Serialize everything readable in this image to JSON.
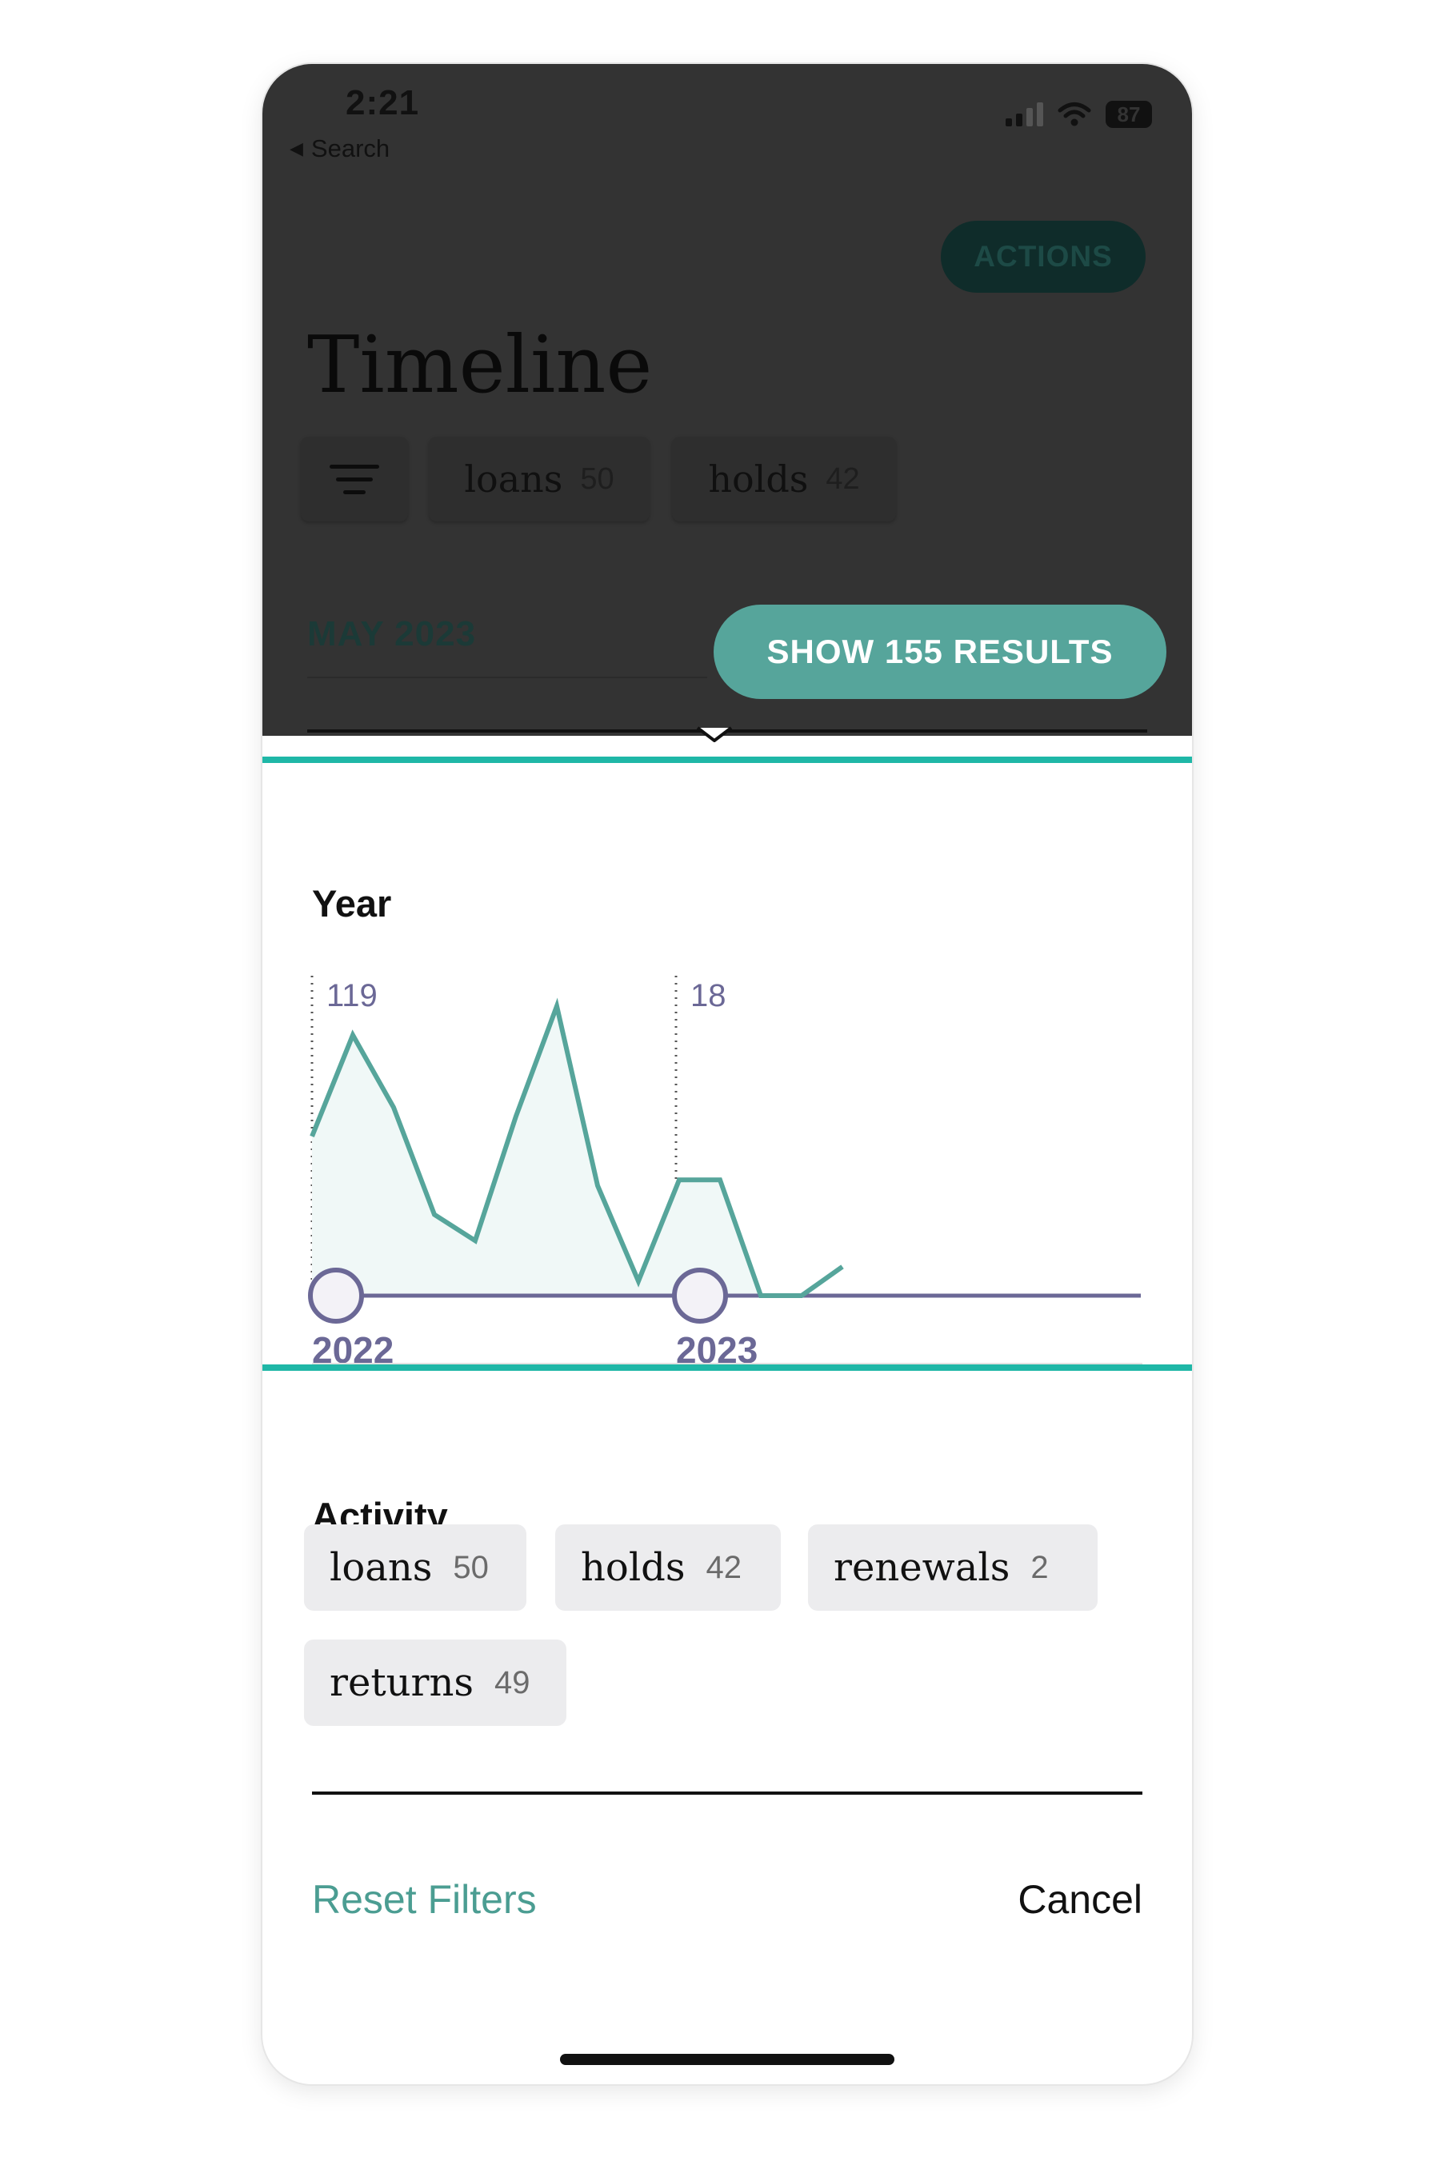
{
  "status_bar": {
    "time": "2:21",
    "back_label": "Search",
    "battery": "87"
  },
  "header": {
    "actions_label": "ACTIONS",
    "title": "Timeline",
    "chips": [
      {
        "label": "loans",
        "count": "50"
      },
      {
        "label": "holds",
        "count": "42"
      }
    ]
  },
  "list": {
    "month_label": "MAY 2023"
  },
  "show_results_label": "SHOW 155 RESULTS",
  "year_section": {
    "title": "Year",
    "markers": [
      {
        "year": "2022",
        "count": "119"
      },
      {
        "year": "2023",
        "count": "18"
      }
    ]
  },
  "chart_data": {
    "type": "area",
    "title": "Year",
    "x_labels": [
      "2022",
      "2023"
    ],
    "peak_labels": [
      "119",
      "18"
    ],
    "values": [
      0.55,
      0.9,
      0.65,
      0.28,
      0.19,
      0.62,
      1.0,
      0.38,
      0.05,
      0.4,
      0.4,
      0.0,
      0.0,
      0.1
    ],
    "ylim": [
      0,
      1
    ],
    "grid": false,
    "accent_color": "#56a59b",
    "fill_color": "#f0f8f7",
    "axis_color": "#6b6896"
  },
  "activity_section": {
    "title": "Activity",
    "chips": [
      {
        "label": "loans",
        "count": "50"
      },
      {
        "label": "holds",
        "count": "42"
      },
      {
        "label": "renewals",
        "count": "2"
      },
      {
        "label": "returns",
        "count": "49"
      }
    ]
  },
  "footer": {
    "reset_label": "Reset Filters",
    "cancel_label": "Cancel"
  },
  "colors": {
    "accent": "#56a59b",
    "highlight_border": "#1fb7a7",
    "backdrop": "#333333"
  }
}
